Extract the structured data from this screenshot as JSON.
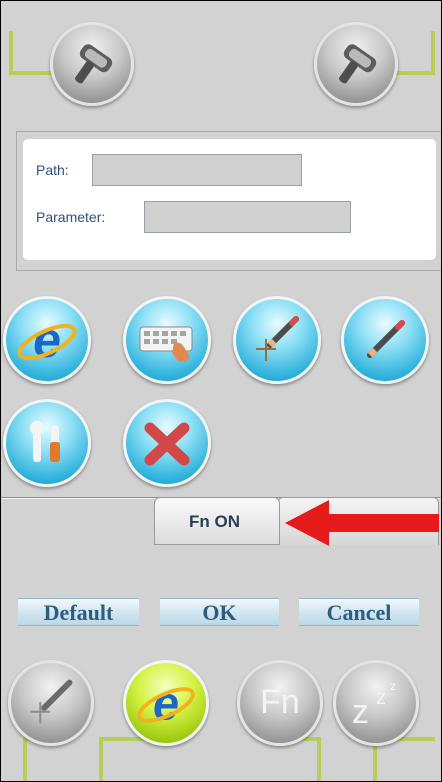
{
  "scanner_buttons": {
    "left_icon": "barcode-scanner-icon",
    "right_icon": "barcode-scanner-icon"
  },
  "path_panel": {
    "path_label": "Path:",
    "path_value": "",
    "parameter_label": "Parameter:",
    "parameter_value": ""
  },
  "function_icons": [
    {
      "name": "internet-explorer-icon"
    },
    {
      "name": "keyboard-icon"
    },
    {
      "name": "crosshair-pen-icon"
    },
    {
      "name": "pen-icon"
    },
    {
      "name": "tools-icon"
    },
    {
      "name": "close-icon"
    }
  ],
  "tabs": {
    "active_label": "Fn ON",
    "inactive_label": ""
  },
  "annotation": {
    "arrow_color": "#e51b1b"
  },
  "actions": {
    "default_label": "Default",
    "ok_label": "OK",
    "cancel_label": "Cancel"
  },
  "bottom_bar": [
    {
      "name": "crosshair-pen-icon"
    },
    {
      "name": "internet-explorer-icon"
    },
    {
      "name": "fn-key-icon",
      "label": "Fn"
    },
    {
      "name": "sleep-icon",
      "label": "z"
    }
  ],
  "colors": {
    "accent_green": "#b7cf5a",
    "label_blue": "#2d4f8a",
    "arrow_red": "#e51b1b"
  }
}
